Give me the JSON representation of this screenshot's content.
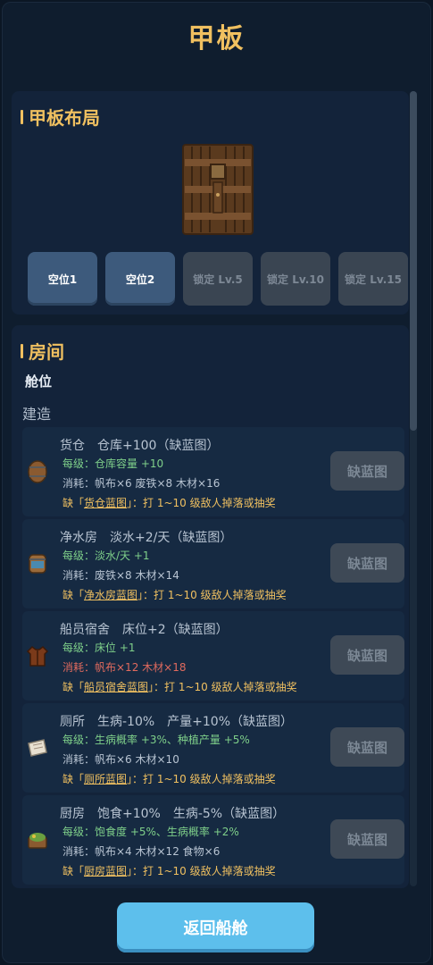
{
  "title": "甲板",
  "deck_layout": {
    "heading": "甲板布局",
    "slots": [
      {
        "label": "空位1",
        "state": "open"
      },
      {
        "label": "空位2",
        "state": "open"
      },
      {
        "label": "锁定 Lv.5",
        "state": "locked"
      },
      {
        "label": "锁定 Lv.10",
        "state": "locked"
      },
      {
        "label": "锁定 Lv.15",
        "state": "locked"
      }
    ]
  },
  "rooms": {
    "heading": "房间",
    "berth_label": "舱位",
    "build_label": "建造",
    "items": [
      {
        "icon": "barrel-icon",
        "title": "货仓　仓库+100（缺蓝图）",
        "level_prefix": "每级：",
        "level_effect": "仓库容量 +10",
        "cost": "消耗：帆布×6  废铁×8  木材×16",
        "cost_warn": false,
        "missing_prefix": "缺「",
        "missing_name": "货仓蓝图",
        "missing_suffix": "」：打 1~10 级敌人掉落或抽奖",
        "button": "缺蓝图"
      },
      {
        "icon": "water-barrel-icon",
        "title": "净水房　淡水+2/天（缺蓝图）",
        "level_prefix": "每级：",
        "level_effect": "淡水/天 +1",
        "cost": "消耗：废铁×8  木材×14",
        "cost_warn": false,
        "missing_prefix": "缺「",
        "missing_name": "净水房蓝图",
        "missing_suffix": "」：打 1~10 级敌人掉落或抽奖",
        "button": "缺蓝图"
      },
      {
        "icon": "vest-icon",
        "title": "船员宿舍　床位+2（缺蓝图）",
        "level_prefix": "每级：",
        "level_effect": "床位 +1",
        "cost": "消耗：帆布×12  木材×18",
        "cost_warn": true,
        "missing_prefix": "缺「",
        "missing_name": "船员宿舍蓝图",
        "missing_suffix": "」：打 1~10 级敌人掉落或抽奖",
        "button": "缺蓝图"
      },
      {
        "icon": "scroll-icon",
        "title": "厕所　生病-10%　产量+10%（缺蓝图）",
        "level_prefix": "每级：",
        "level_effect": "生病概率 +3%、种植产量 +5%",
        "cost": "消耗：帆布×6  木材×10",
        "cost_warn": false,
        "missing_prefix": "缺「",
        "missing_name": "厕所蓝图",
        "missing_suffix": "」：打 1~10 级敌人掉落或抽奖",
        "button": "缺蓝图"
      },
      {
        "icon": "planter-icon",
        "title": "厨房　饱食+10%　生病-5%（缺蓝图）",
        "level_prefix": "每级：",
        "level_effect": "饱食度 +5%、生病概率 +2%",
        "cost": "消耗：帆布×4  木材×12  食物×6",
        "cost_warn": false,
        "missing_prefix": "缺「",
        "missing_name": "厨房蓝图",
        "missing_suffix": "」：打 1~10 级敌人掉落或抽奖",
        "button": "缺蓝图"
      }
    ]
  },
  "return_button": "返回船舱",
  "colors": {
    "gold": "#f0c060",
    "green": "#7fd08a",
    "red": "#e06a5e",
    "accent": "#5dbfec"
  }
}
